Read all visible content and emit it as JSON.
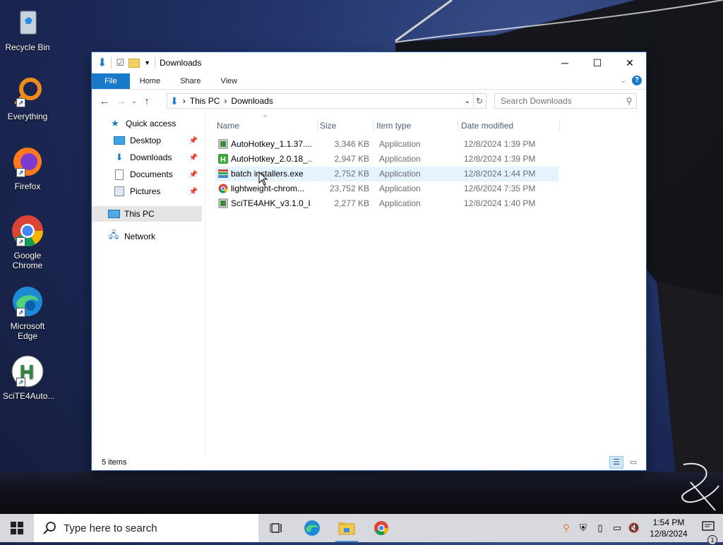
{
  "desktop": {
    "icons": [
      {
        "label": "Recycle Bin"
      },
      {
        "label": "Everything"
      },
      {
        "label": "Firefox"
      },
      {
        "label": "Google Chrome"
      },
      {
        "label": "Microsoft Edge"
      },
      {
        "label": "SciTE4Auto..."
      }
    ]
  },
  "window": {
    "title": "Downloads",
    "ribbon_tabs": {
      "file": "File",
      "home": "Home",
      "share": "Share",
      "view": "View"
    },
    "breadcrumb": {
      "root": "This PC",
      "current": "Downloads"
    },
    "search_placeholder": "Search Downloads",
    "nav": {
      "quick_access": "Quick access",
      "desktop": "Desktop",
      "downloads": "Downloads",
      "documents": "Documents",
      "pictures": "Pictures",
      "this_pc": "This PC",
      "network": "Network"
    },
    "columns": {
      "name": "Name",
      "size": "Size",
      "type": "Item type",
      "date": "Date modified"
    },
    "files": [
      {
        "name": "AutoHotkey_1.1.37....",
        "size": "3,346 KB",
        "type": "Application",
        "date": "12/8/2024 1:39 PM",
        "icon": "ahk-icon"
      },
      {
        "name": "AutoHotkey_2.0.18_...",
        "size": "2,947 KB",
        "type": "Application",
        "date": "12/8/2024 1:39 PM",
        "icon": "ahk2-icon"
      },
      {
        "name": "batch installers.exe",
        "size": "2,752 KB",
        "type": "Application",
        "date": "12/8/2024 1:44 PM",
        "icon": "batch-icon"
      },
      {
        "name": "lightweight-chrom...",
        "size": "23,752 KB",
        "type": "Application",
        "date": "12/6/2024 7:35 PM",
        "icon": "chrome-icon"
      },
      {
        "name": "SciTE4AHK_v3.1.0_I...",
        "size": "2,277 KB",
        "type": "Application",
        "date": "12/8/2024 1:40 PM",
        "icon": "scite-icon"
      }
    ],
    "status": "5 items"
  },
  "taskbar": {
    "search_text": "Type here to search",
    "time": "1:54 PM",
    "date": "12/8/2024",
    "notification_count": "1"
  },
  "colors": {
    "accent": "#1979ca",
    "taskbar": "#d7d9df",
    "hover_row": "#e5f3ff"
  }
}
